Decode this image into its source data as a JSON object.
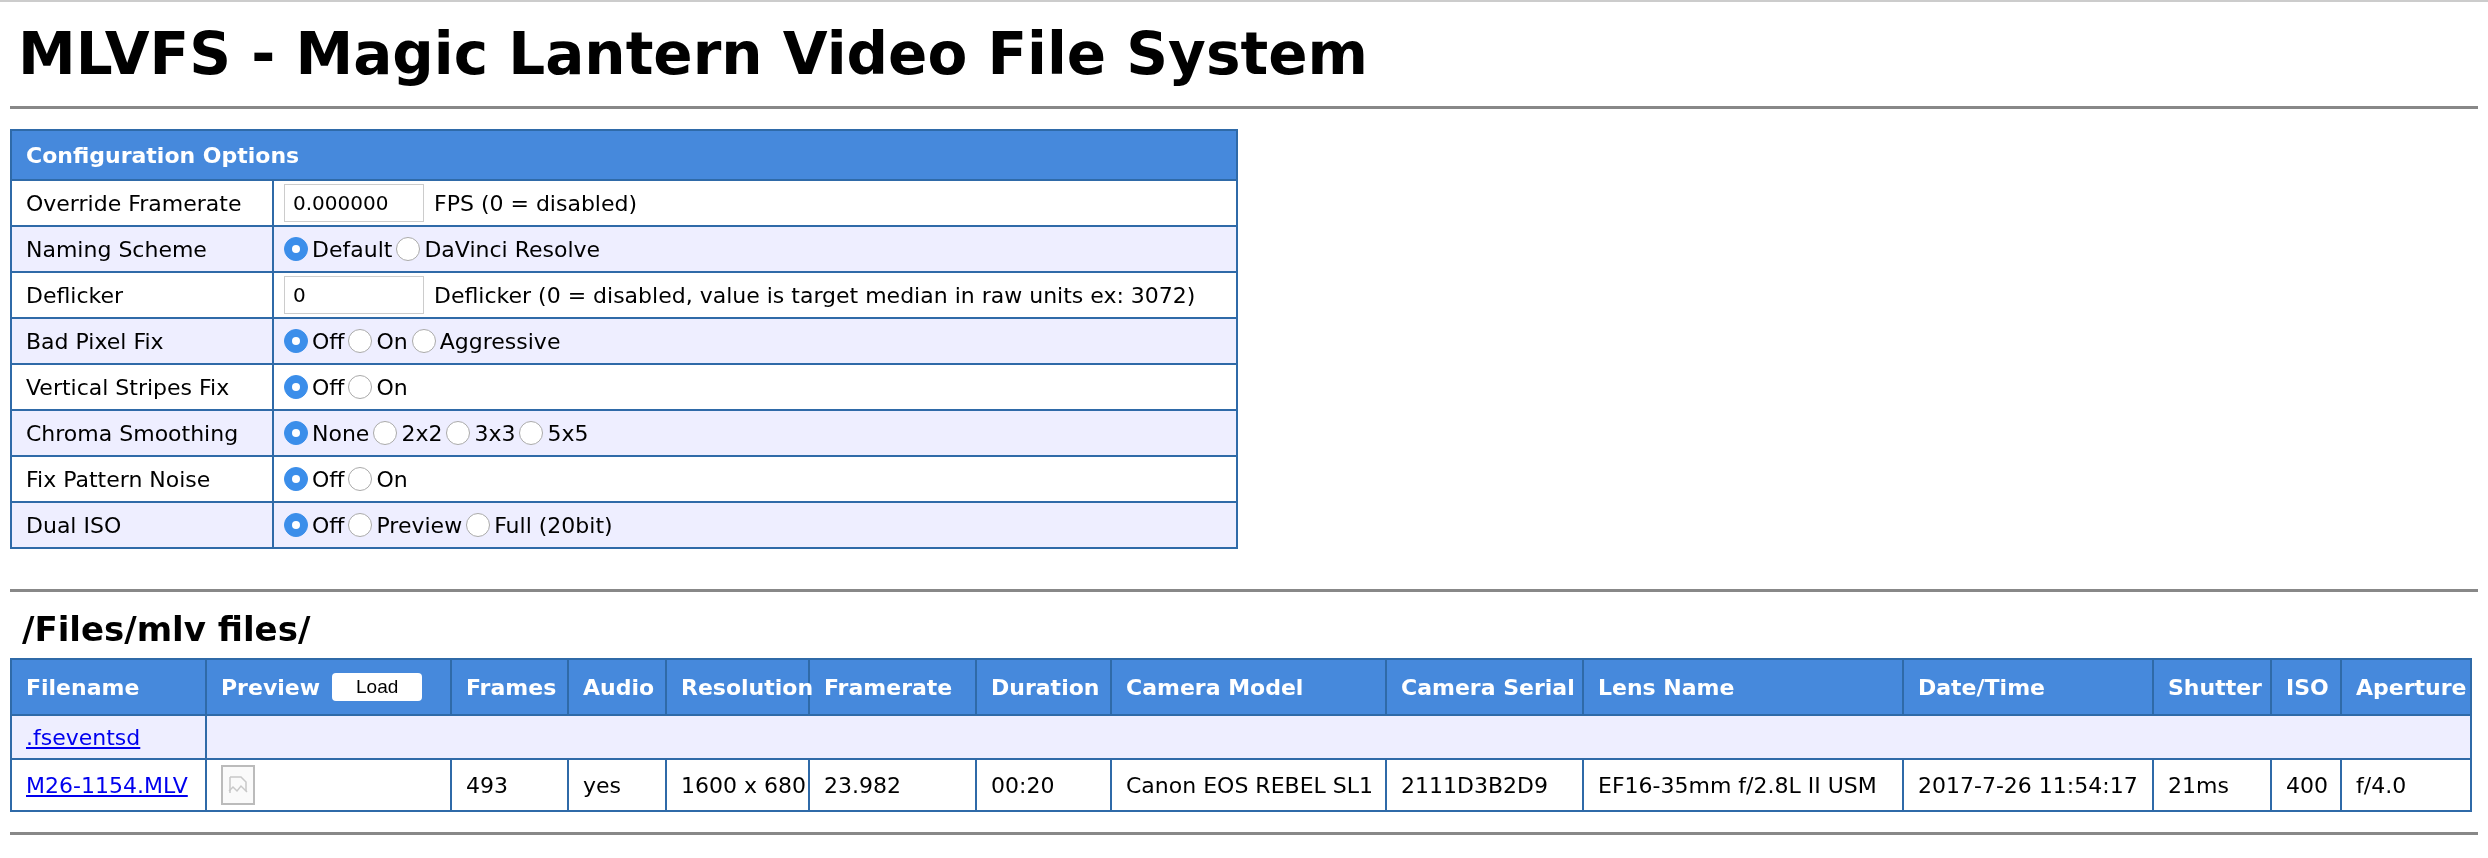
{
  "title": "MLVFS - Magic Lantern Video File System",
  "config": {
    "heading": "Configuration Options",
    "rows": [
      {
        "label": "Override Framerate",
        "kind": "input",
        "value": "0.000000",
        "note": "FPS (0 = disabled)"
      },
      {
        "label": "Naming Scheme",
        "kind": "radio",
        "options": [
          {
            "label": "Default",
            "selected": true
          },
          {
            "label": "DaVinci Resolve",
            "selected": false
          }
        ]
      },
      {
        "label": "Deflicker",
        "kind": "input",
        "value": "0",
        "note": "Deflicker (0 = disabled, value is target median in raw units ex: 3072)"
      },
      {
        "label": "Bad Pixel Fix",
        "kind": "radio",
        "options": [
          {
            "label": "Off",
            "selected": true
          },
          {
            "label": "On",
            "selected": false
          },
          {
            "label": "Aggressive",
            "selected": false
          }
        ]
      },
      {
        "label": "Vertical Stripes Fix",
        "kind": "radio",
        "options": [
          {
            "label": "Off",
            "selected": true
          },
          {
            "label": "On",
            "selected": false
          }
        ]
      },
      {
        "label": "Chroma Smoothing",
        "kind": "radio",
        "options": [
          {
            "label": "None",
            "selected": true
          },
          {
            "label": "2x2",
            "selected": false
          },
          {
            "label": "3x3",
            "selected": false
          },
          {
            "label": "5x5",
            "selected": false
          }
        ]
      },
      {
        "label": "Fix Pattern Noise",
        "kind": "radio",
        "options": [
          {
            "label": "Off",
            "selected": true
          },
          {
            "label": "On",
            "selected": false
          }
        ]
      },
      {
        "label": "Dual ISO",
        "kind": "radio",
        "options": [
          {
            "label": "Off",
            "selected": true
          },
          {
            "label": "Preview",
            "selected": false
          },
          {
            "label": "Full (20bit)",
            "selected": false
          }
        ]
      }
    ]
  },
  "files": {
    "path": "/Files/mlv files/",
    "columns": [
      {
        "label": "Filename"
      },
      {
        "label": "Preview",
        "button": "Load"
      },
      {
        "label": "Frames"
      },
      {
        "label": "Audio"
      },
      {
        "label": "Resolution"
      },
      {
        "label": "Framerate"
      },
      {
        "label": "Duration"
      },
      {
        "label": "Camera Model"
      },
      {
        "label": "Camera Serial"
      },
      {
        "label": "Lens Name"
      },
      {
        "label": "Date/Time"
      },
      {
        "label": "Shutter"
      },
      {
        "label": "ISO"
      },
      {
        "label": "Aperture"
      }
    ],
    "rows": [
      {
        "kind": "folder",
        "filename": ".fseventsd"
      },
      {
        "kind": "file",
        "filename": "M26-1154.MLV",
        "cells": [
          "493",
          "yes",
          "1600 x 680",
          "23.982",
          "00:20",
          "Canon EOS REBEL SL1",
          "2111D3B2D9",
          "EF16-35mm f/2.8L II USM",
          "2017-7-26 11:54:17",
          "21ms",
          "400",
          "f/4.0"
        ]
      }
    ]
  }
}
